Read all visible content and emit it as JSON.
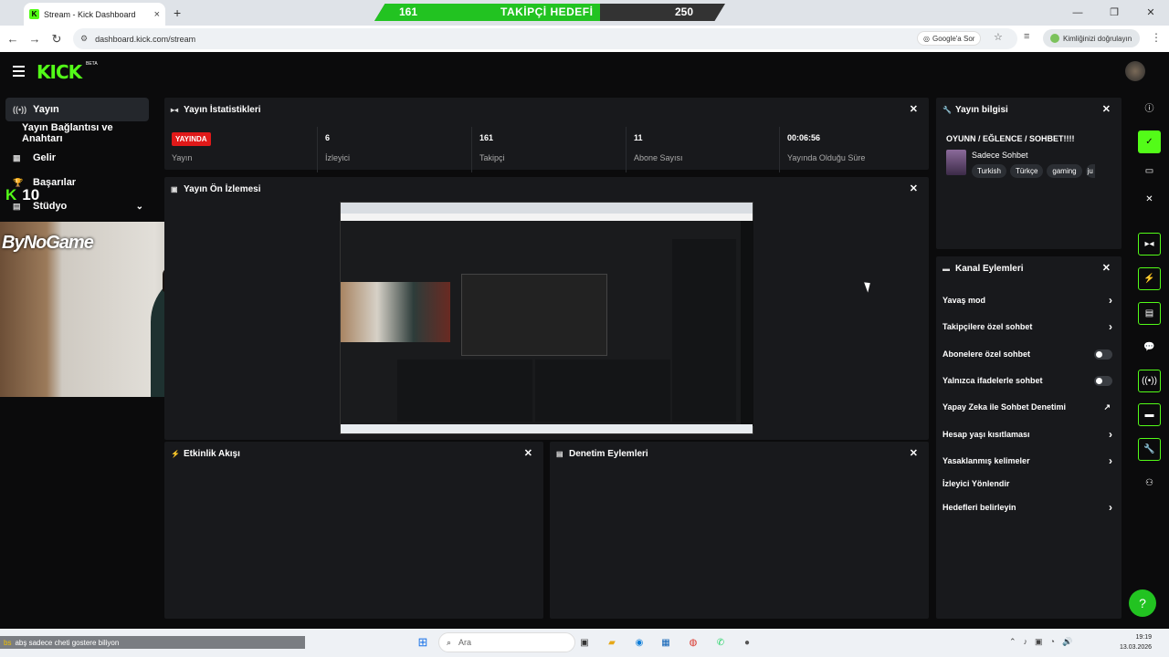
{
  "browser": {
    "tab_title": "Stream - Kick Dashboard",
    "url": "dashboard.kick.com/stream",
    "google_sor": "Google'a Sor",
    "verify_label": "Kimliğinizi doğrulayın",
    "window_buttons": [
      "—",
      "❐",
      "✕"
    ]
  },
  "goal_overlay": {
    "current": "161",
    "label": "TAKİPÇİ HEDEFİ",
    "target": "250",
    "progress": 0.644
  },
  "sidebar": {
    "items": [
      {
        "icon": "((•))",
        "label": "Yayın"
      },
      {
        "icon": "",
        "label": "Yayın Bağlantısı ve Anahtarı"
      },
      {
        "icon": "▦",
        "label": "Gelir"
      },
      {
        "icon": "🏆",
        "label": "Başarılar"
      },
      {
        "icon": "▤",
        "label": "Stüdyo"
      }
    ]
  },
  "webcam_overlay": {
    "brand": "ByNoGame",
    "badge_logo": "K",
    "badge_count": "10"
  },
  "stats_panel": {
    "title": "Yayın İstatistikleri",
    "live_badge": "YAYINDA",
    "items": [
      {
        "value": "",
        "label": "Yayın"
      },
      {
        "value": "6",
        "label": "İzleyici"
      },
      {
        "value": "161",
        "label": "Takipçi"
      },
      {
        "value": "11",
        "label": "Abone Sayısı"
      },
      {
        "value": "00:06:56",
        "label": "Yayında Olduğu Süre"
      }
    ]
  },
  "preview_panel": {
    "title": "Yayın Ön İzlemesi"
  },
  "activity_panel": {
    "title": "Etkinlik Akışı"
  },
  "moderation_panel": {
    "title": "Denetim Eylemleri"
  },
  "stream_info": {
    "title": "Yayın bilgisi",
    "stream_title": "OYUNN / EĞLENCE / SOHBET!!!!",
    "category": "Sadece Sohbet",
    "tags": [
      "Turkish",
      "Türkçe",
      "gaming",
      "ju"
    ]
  },
  "channel_actions": {
    "title": "Kanal Eylemleri",
    "items": [
      {
        "label": "Yavaş mod",
        "control": "arrow"
      },
      {
        "label": "Takipçilere özel sohbet",
        "control": "arrow"
      },
      {
        "label": "Abonelere özel sohbet",
        "control": "toggle"
      },
      {
        "label": "Yalnızca ifadelerle sohbet",
        "control": "toggle"
      },
      {
        "label": "Yapay Zeka ile Sohbet Denetimi",
        "control": "external"
      },
      {
        "label": "Hesap yaşı kısıtlaması",
        "control": "arrow"
      },
      {
        "label": "Yasaklanmış kelimeler",
        "control": "arrow"
      },
      {
        "label": "İzleyici Yönlendir",
        "control": "none"
      },
      {
        "label": "Hedefleri belirleyin",
        "control": "arrow"
      }
    ]
  },
  "taskbar": {
    "notification_user": "bs",
    "notification_text": "abş sadece cheti gostere biliyon",
    "search_placeholder": "Ara",
    "time": "19:19",
    "date": "13.03.2026"
  },
  "colors": {
    "accent": "#53fc18",
    "live": "#e01919",
    "panel": "#18191c",
    "background": "#0b0b0c"
  }
}
